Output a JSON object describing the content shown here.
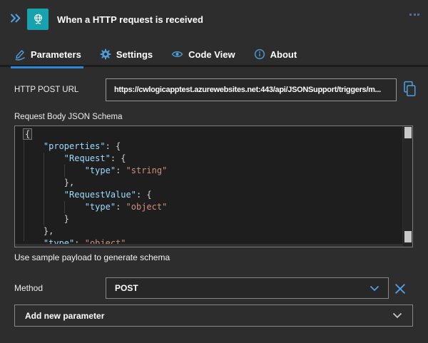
{
  "header": {
    "title": "When a HTTP request is received",
    "trigger_icon": "http-request-trigger-icon",
    "expand_icon": "double-chevron-right-icon",
    "overflow_icon": "ellipsis-menu-icon"
  },
  "tabs": [
    {
      "label": "Parameters",
      "icon": "signature-icon",
      "active": true
    },
    {
      "label": "Settings",
      "icon": "gear-icon",
      "active": false
    },
    {
      "label": "Code View",
      "icon": "eye-icon",
      "active": false
    },
    {
      "label": "About",
      "icon": "info-icon",
      "active": false
    }
  ],
  "url_field": {
    "label": "HTTP POST URL",
    "value": "https://cwlogicapptest.azurewebsites.net:443/api/JSONSupport/triggers/m...",
    "copy_icon": "copy-icon"
  },
  "schema_editor": {
    "label": "Request Body JSON Schema",
    "lines": [
      [
        [
          "b",
          "{"
        ]
      ],
      [
        [
          "p",
          "    "
        ],
        [
          "k",
          "\"properties\""
        ],
        [
          "p",
          ": {"
        ]
      ],
      [
        [
          "p",
          "        "
        ],
        [
          "k",
          "\"Request\""
        ],
        [
          "p",
          ": {"
        ]
      ],
      [
        [
          "p",
          "            "
        ],
        [
          "k",
          "\"type\""
        ],
        [
          "p",
          ": "
        ],
        [
          "s",
          "\"string\""
        ]
      ],
      [
        [
          "p",
          "        },"
        ]
      ],
      [
        [
          "p",
          "        "
        ],
        [
          "k",
          "\"RequestValue\""
        ],
        [
          "p",
          ": {"
        ]
      ],
      [
        [
          "p",
          "            "
        ],
        [
          "k",
          "\"type\""
        ],
        [
          "p",
          ": "
        ],
        [
          "s",
          "\"object\""
        ]
      ],
      [
        [
          "p",
          "        }"
        ]
      ],
      [
        [
          "p",
          "    },"
        ]
      ],
      [
        [
          "p",
          "    "
        ],
        [
          "k",
          "\"type\""
        ],
        [
          "p",
          ": "
        ],
        [
          "s",
          "\"object\""
        ]
      ]
    ]
  },
  "sample_payload_link": "Use sample payload to generate schema",
  "method_field": {
    "label": "Method",
    "value": "POST"
  },
  "add_parameter": {
    "label": "Add new parameter"
  },
  "colors": {
    "panel_bg": "#2d2d2d",
    "editor_bg": "#1e1e1e",
    "accent_blue": "#4da0dd",
    "tab_underline": "#2b88d8",
    "trigger_teal": "#16a3ad",
    "editor_key": "#9cdcfe",
    "editor_string": "#ce9178",
    "editor_punctuation": "#d4d4d4"
  }
}
